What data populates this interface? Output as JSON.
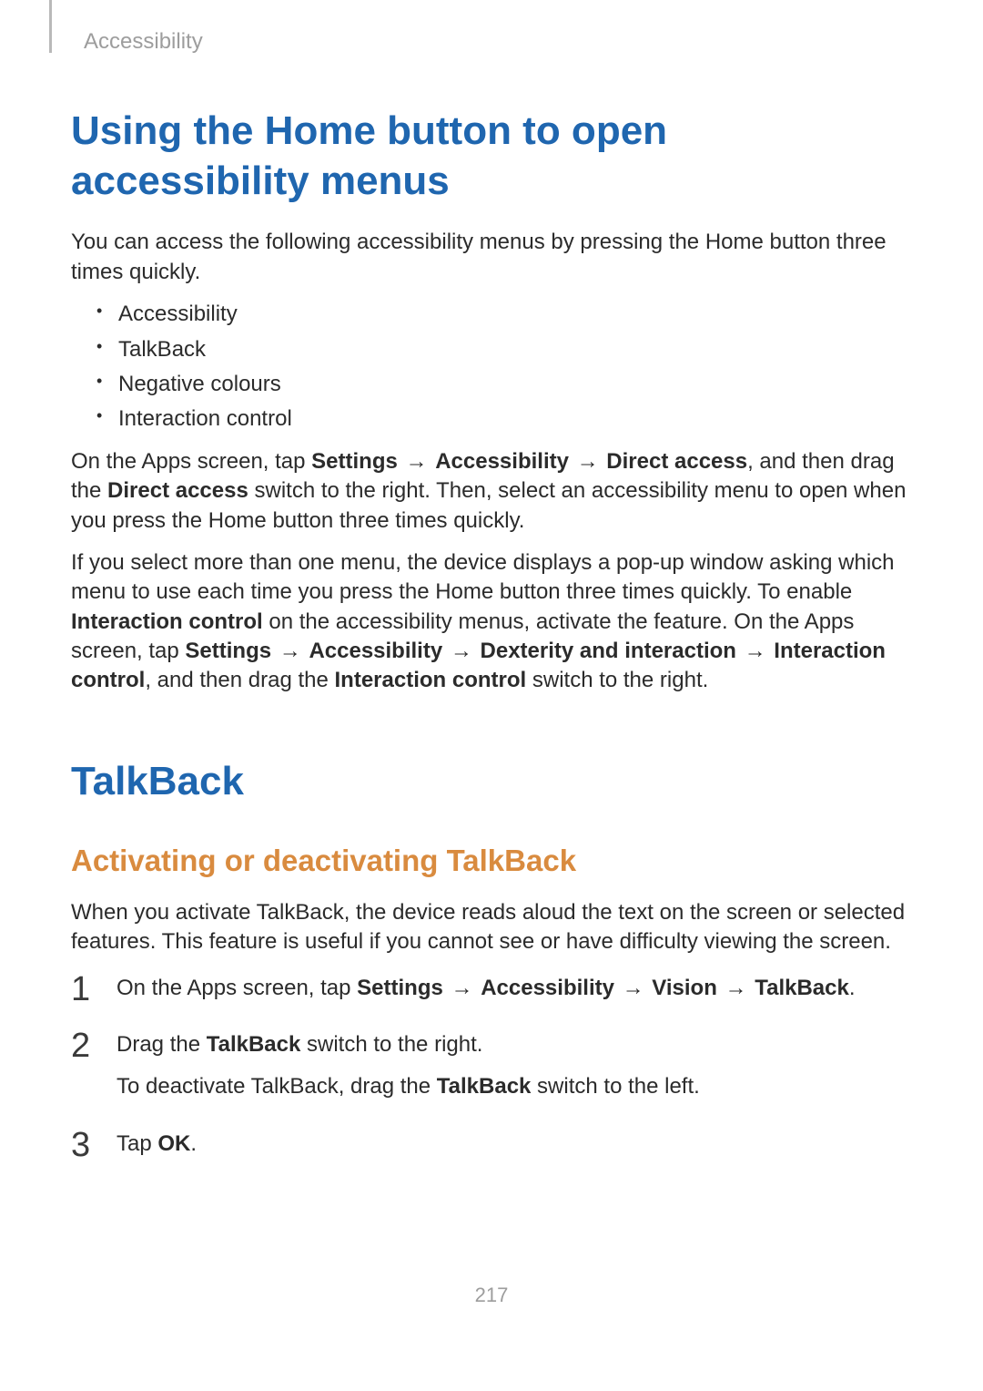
{
  "breadcrumb": "Accessibility",
  "sections": {
    "home_button": {
      "title": "Using the Home button to open accessibility menus",
      "intro": "You can access the following accessibility menus by pressing the Home button three times quickly.",
      "bullets": [
        "Accessibility",
        "TalkBack",
        "Negative colours",
        "Interaction control"
      ],
      "para1": {
        "pre": "On the Apps screen, tap ",
        "b1": "Settings",
        "arr1": " → ",
        "b2": "Accessibility",
        "arr2": " → ",
        "b3": "Direct access",
        "mid": ", and then drag the ",
        "b4": "Direct access",
        "post": " switch to the right. Then, select an accessibility menu to open when you press the Home button three times quickly."
      },
      "para2": {
        "pre": "If you select more than one menu, the device displays a pop-up window asking which menu to use each time you press the Home button three times quickly. To enable ",
        "b1": "Interaction control",
        "mid1": " on the accessibility menus, activate the feature. On the Apps screen, tap ",
        "b2": "Settings",
        "arr1": " → ",
        "b3": "Accessibility",
        "arr2": " → ",
        "b4": "Dexterity and interaction",
        "arr3": " → ",
        "b5": "Interaction control",
        "mid2": ", and then drag the ",
        "b6": "Interaction control",
        "post": " switch to the right."
      }
    },
    "talkback": {
      "title": "TalkBack",
      "subheading": "Activating or deactivating TalkBack",
      "intro": "When you activate TalkBack, the device reads aloud the text on the screen or selected features. This feature is useful if you cannot see or have difficulty viewing the screen.",
      "steps": {
        "s1": {
          "pre": "On the Apps screen, tap ",
          "b1": "Settings",
          "arr1": " → ",
          "b2": "Accessibility",
          "arr2": " → ",
          "b3": "Vision",
          "arr3": " → ",
          "b4": "TalkBack",
          "post": "."
        },
        "s2": {
          "pre": "Drag the ",
          "b1": "TalkBack",
          "post": " switch to the right.",
          "sub_pre": "To deactivate TalkBack, drag the ",
          "sub_b1": "TalkBack",
          "sub_post": " switch to the left."
        },
        "s3": {
          "pre": "Tap ",
          "b1": "OK",
          "post": "."
        }
      }
    }
  },
  "page_number": "217"
}
